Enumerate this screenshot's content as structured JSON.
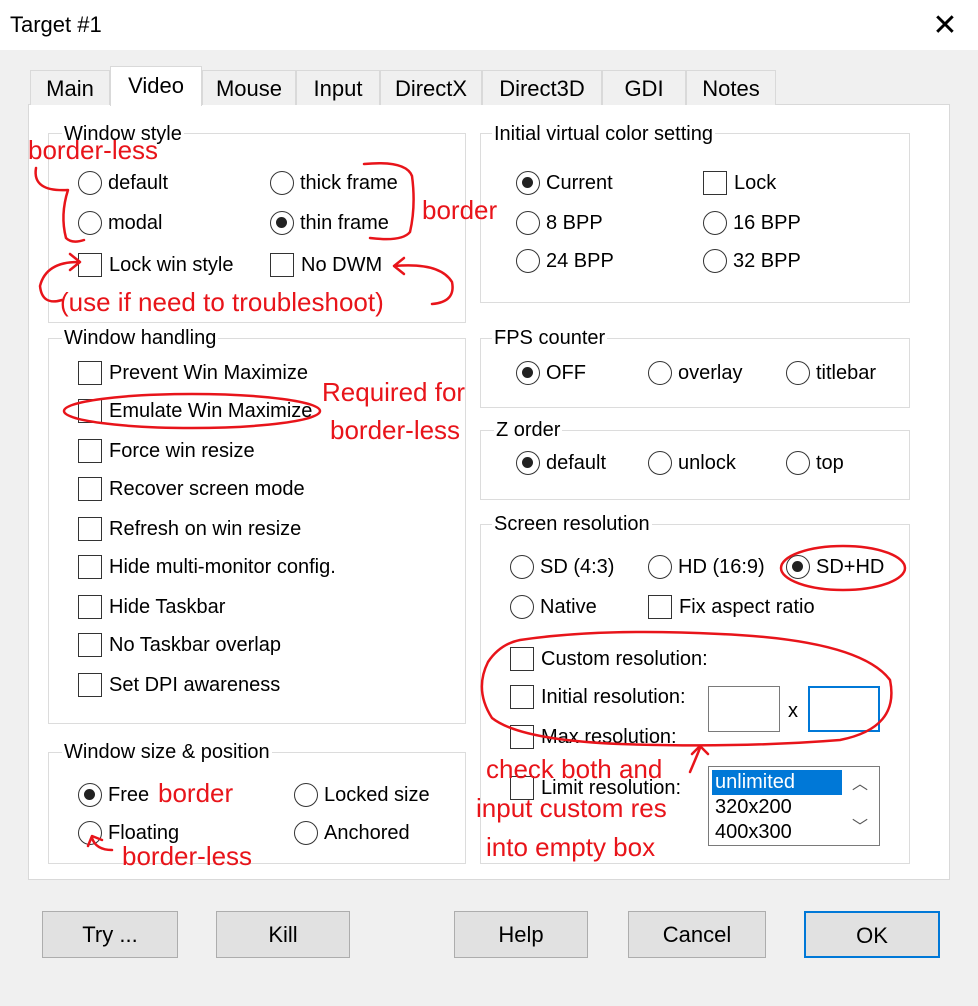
{
  "window": {
    "title": "Target #1"
  },
  "tabs": [
    "Main",
    "Video",
    "Mouse",
    "Input",
    "DirectX",
    "Direct3D",
    "GDI",
    "Notes"
  ],
  "window_style": {
    "label": "Window style",
    "default": "default",
    "thick_frame": "thick frame",
    "modal": "modal",
    "thin_frame": "thin frame",
    "lock_win_style": "Lock win style",
    "no_dwm": "No DWM",
    "selected": "thin frame"
  },
  "color_setting": {
    "label": "Initial virtual color setting",
    "current": "Current",
    "lock": "Lock",
    "bpp8": "8 BPP",
    "bpp16": "16 BPP",
    "bpp24": "24 BPP",
    "bpp32": "32 BPP",
    "selected": "Current"
  },
  "window_handling": {
    "label": "Window handling",
    "items": [
      "Prevent Win Maximize",
      "Emulate Win Maximize",
      "Force win resize",
      "Recover screen mode",
      "Refresh on win resize",
      "Hide multi-monitor config.",
      "Hide Taskbar",
      "No Taskbar overlap",
      "Set DPI awareness"
    ]
  },
  "fps_counter": {
    "label": "FPS counter",
    "off": "OFF",
    "overlay": "overlay",
    "titlebar": "titlebar",
    "selected": "OFF"
  },
  "z_order": {
    "label": "Z order",
    "default": "default",
    "unlock": "unlock",
    "top": "top",
    "selected": "default"
  },
  "screen_resolution": {
    "label": "Screen resolution",
    "sd": "SD (4:3)",
    "hd": "HD (16:9)",
    "sdhd": "SD+HD",
    "native": "Native",
    "fix_aspect": "Fix aspect ratio",
    "custom": "Custom resolution:",
    "initial": "Initial resolution:",
    "x_sep": "x",
    "max": "Max resolution:",
    "limit": "Limit  resolution:",
    "width_value": "",
    "height_value": "",
    "list": [
      "unlimited",
      "320x200",
      "400x300"
    ],
    "selected": "SD+HD"
  },
  "size_position": {
    "label": "Window size & position",
    "free": "Free",
    "locked": "Locked size",
    "floating": "Floating",
    "anchored": "Anchored",
    "selected": "Free"
  },
  "buttons": {
    "try": "Try ...",
    "kill": "Kill",
    "help": "Help",
    "cancel": "Cancel",
    "ok": "OK"
  },
  "scroll_icons": {
    "up": "chevron-up-icon",
    "down": "chevron-down-icon"
  },
  "annotations": {
    "color": "#e8141a",
    "borderless_top": "border-less",
    "border_style": "border",
    "troubleshoot": "(use if need to troubleshoot)",
    "required_1": "Required for",
    "required_2": "border-less",
    "check_1": "check both and",
    "check_2": "input custom res",
    "check_3": "into empty box",
    "free_border": "border",
    "floating_borderless": "border-less"
  },
  "colors": {
    "accent": "#0078d7",
    "annotation": "#e8141a",
    "dialog_bg": "#f0f0f0"
  }
}
